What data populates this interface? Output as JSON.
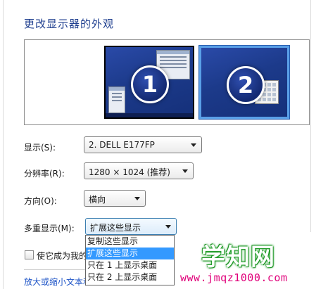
{
  "page": {
    "title": "更改显示器的外观"
  },
  "monitors": [
    {
      "number": "1",
      "selected": false
    },
    {
      "number": "2",
      "selected": true
    }
  ],
  "display": {
    "label": "显示(S):",
    "value": "2. DELL E177FP"
  },
  "resolution": {
    "label": "分辨率(R):",
    "value": "1280 × 1024 (推荐)"
  },
  "orientation": {
    "label": "方向(O):",
    "value": "横向"
  },
  "multiple_displays": {
    "label": "多重显示(M):",
    "value": "扩展这些显示",
    "options": [
      "复制这些显示",
      "扩展这些显示",
      "只在 1 上显示桌面",
      "只在 2 上显示桌面"
    ],
    "selected_index": 1
  },
  "main_display_checkbox": {
    "label": "使它成为我的主显示器",
    "checked": false
  },
  "text_size_link": "放大或缩小文本和其他项目",
  "watermark": {
    "brand": "学知网",
    "url": "www.jmqz1000.com"
  },
  "colors": {
    "title": "#1f3f8f",
    "selection": "#3399ff",
    "link": "#1f55c7",
    "watermark_green": "#23a12b",
    "watermark_url": "#e0007a"
  }
}
